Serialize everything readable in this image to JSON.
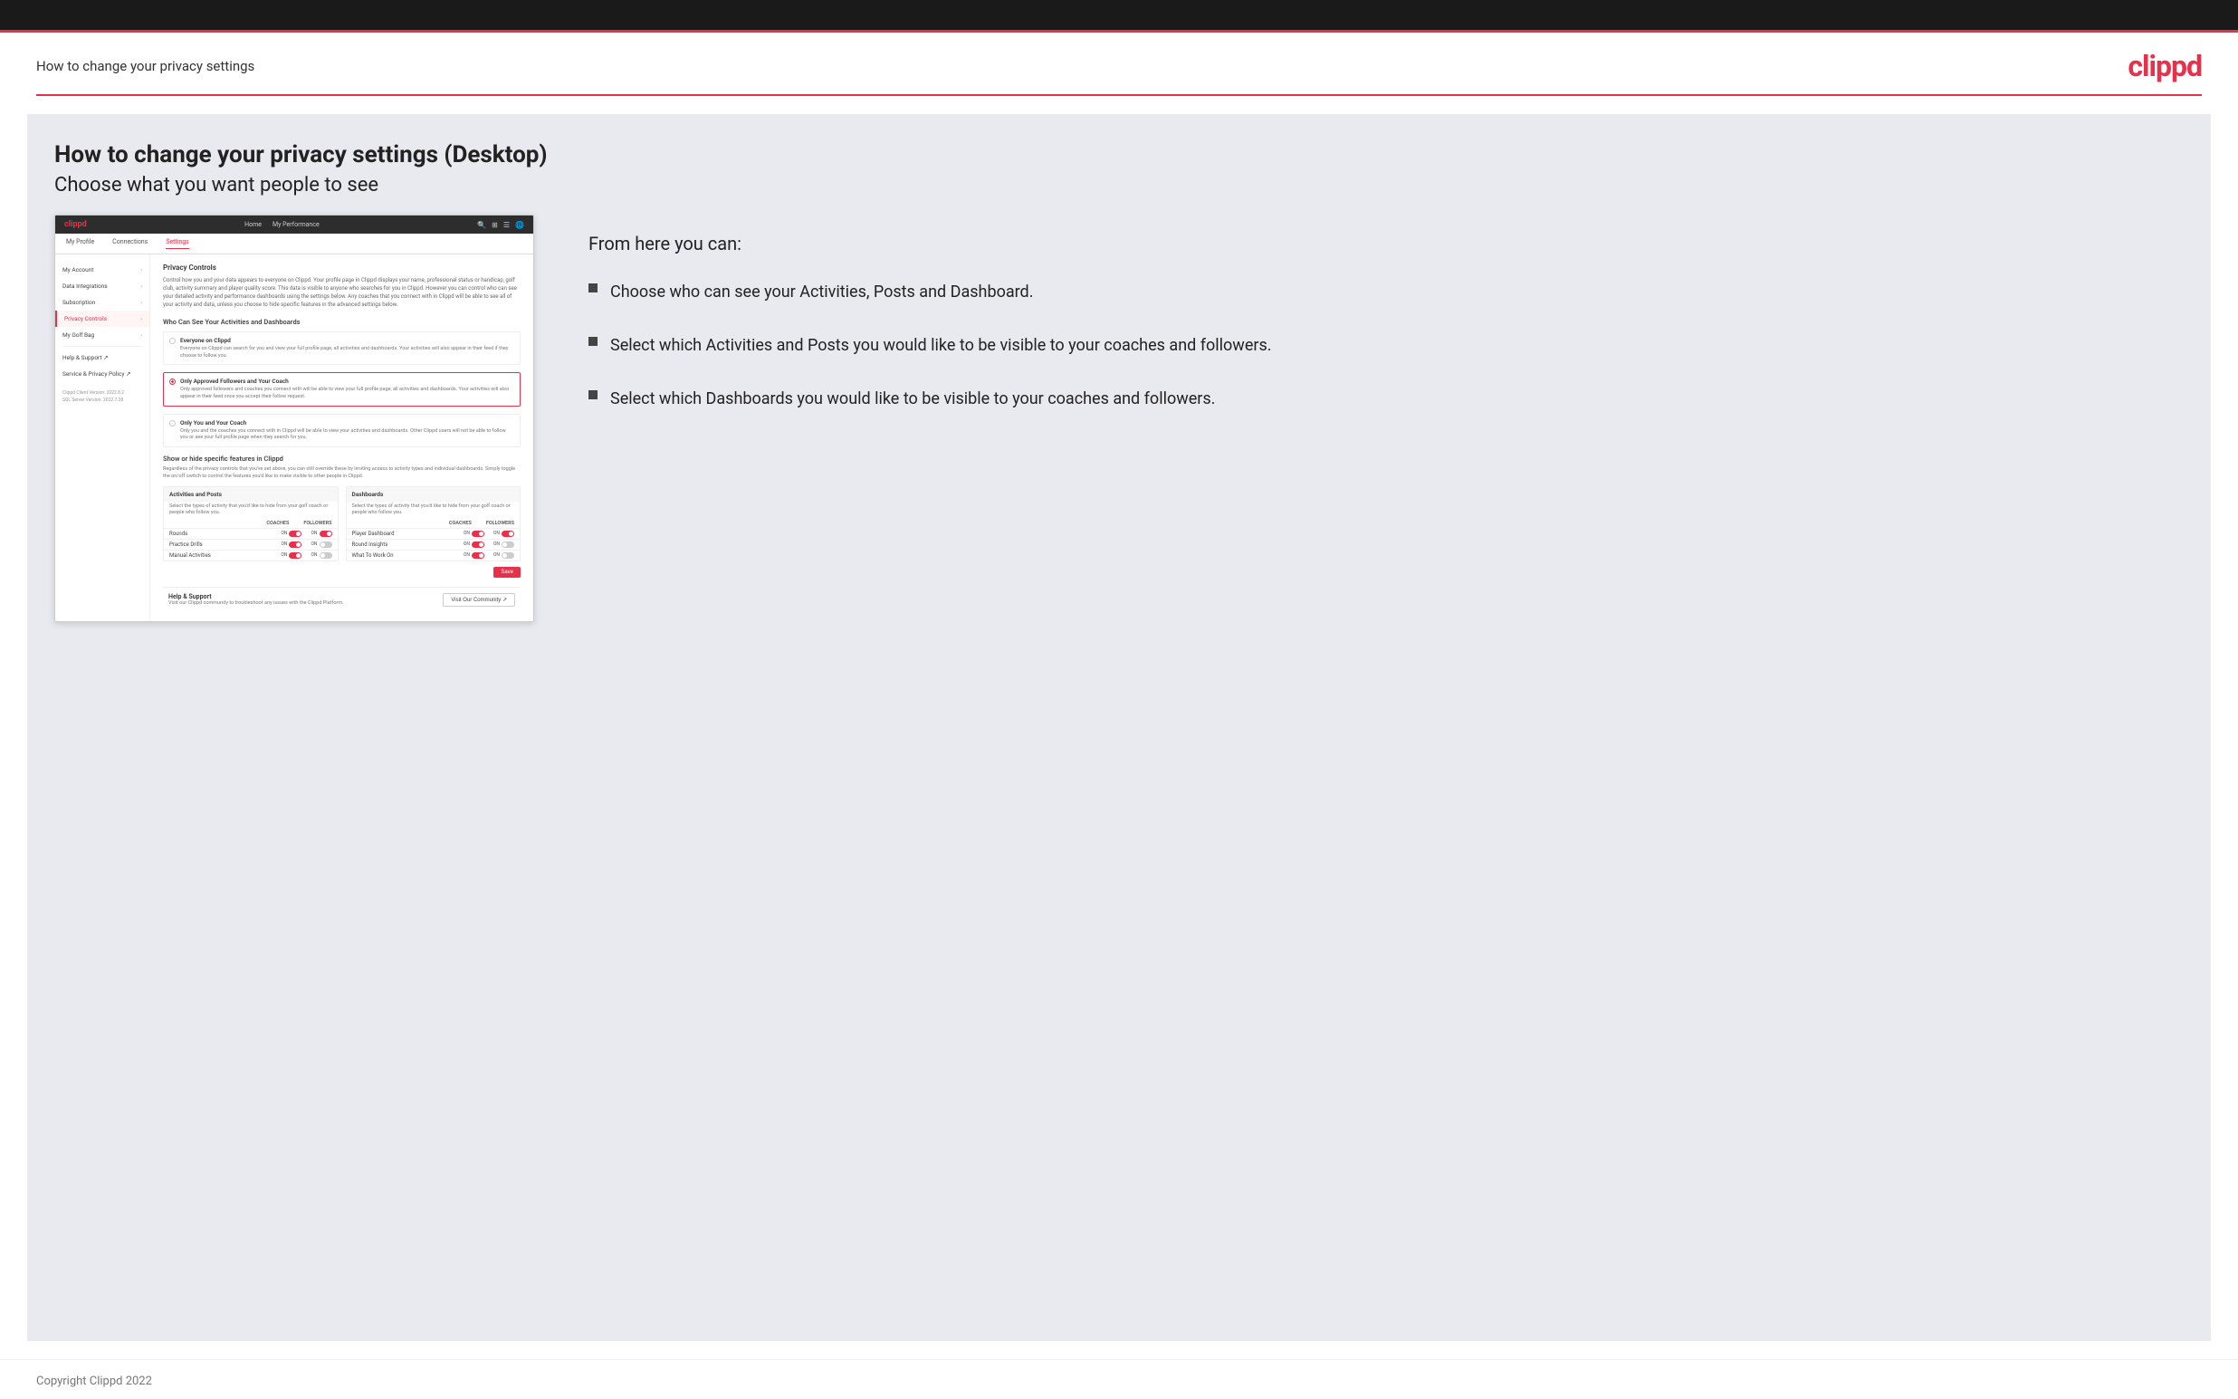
{
  "topBar": {},
  "header": {
    "title": "How to change your privacy settings",
    "logo": "clippd"
  },
  "main": {
    "title": "How to change your privacy settings (Desktop)",
    "subtitle": "Choose what you want people to see",
    "mockup": {
      "nav": {
        "logo": "clippd",
        "links": [
          "Home",
          "My Performance"
        ],
        "icons": [
          "🔍",
          "⊞",
          "☰",
          "🌐"
        ]
      },
      "subnav": [
        "My Profile",
        "Connections",
        "Settings"
      ],
      "activeSubnav": "Settings",
      "sidebar": {
        "items": [
          {
            "label": "My Account",
            "active": false
          },
          {
            "label": "Data Integrations",
            "active": false
          },
          {
            "label": "Subscription",
            "active": false
          },
          {
            "label": "Privacy Controls",
            "active": true
          },
          {
            "label": "My Golf Bag",
            "active": false
          },
          {
            "label": "Help & Support ↗",
            "active": false
          },
          {
            "label": "Service & Privacy Policy ↗",
            "active": false
          }
        ],
        "version": "Clippd Client Version: 2022.8.2\nSQL Server Version: 2022.7.38"
      },
      "privacyControls": {
        "sectionTitle": "Privacy Controls",
        "sectionDesc": "Control how you and your data appears to everyone on Clippd. Your profile page in Clippd displays your name, professional status or handicap, golf club, activity summary and player quality score. This data is visible to anyone who searches for you in Clippd. However you can control who can see your detailed activity and performance dashboards using the settings below. Any coaches that you connect with in Clippd will be able to see all of your activity and data, unless you choose to hide specific features in the advanced settings below.",
        "whoTitle": "Who Can See Your Activities and Dashboards",
        "options": [
          {
            "label": "Everyone on Clippd",
            "desc": "Everyone on Clippd can search for you and view your full profile page, all activities and dashboards. Your activities will also appear in their feed if they choose to follow you.",
            "selected": false
          },
          {
            "label": "Only Approved Followers and Your Coach",
            "desc": "Only approved followers and coaches you connect with will be able to view your full profile page, all activities and dashboards. Your activities will also appear in their feed once you accept their follow request.",
            "selected": true
          },
          {
            "label": "Only You and Your Coach",
            "desc": "Only you and the coaches you connect with in Clippd will be able to view your activities and dashboards. Other Clippd users will not be able to follow you or see your full profile page when they search for you.",
            "selected": false
          }
        ],
        "showTitle": "Show or hide specific features in Clippd",
        "showDesc": "Regardless of the privacy controls that you've set above, you can still override these by limiting access to activity types and individual dashboards. Simply toggle the on/off switch to control the features you'd like to make visible to other people in Clippd.",
        "activitiesTable": {
          "title": "Activities and Posts",
          "desc": "Select the types of activity that you'd like to hide from your golf coach or people who follow you.",
          "colHeaders": [
            "COACHES",
            "FOLLOWERS"
          ],
          "rows": [
            {
              "label": "Rounds",
              "coachesOn": true,
              "followersOn": true
            },
            {
              "label": "Practice Drills",
              "coachesOn": true,
              "followersOn": false
            },
            {
              "label": "Manual Activities",
              "coachesOn": true,
              "followersOn": false
            }
          ]
        },
        "dashboardsTable": {
          "title": "Dashboards",
          "desc": "Select the types of activity that you'd like to hide from your golf coach or people who follow you.",
          "colHeaders": [
            "COACHES",
            "FOLLOWERS"
          ],
          "rows": [
            {
              "label": "Player Dashboard",
              "coachesOn": true,
              "followersOn": true
            },
            {
              "label": "Round Insights",
              "coachesOn": true,
              "followersOn": false
            },
            {
              "label": "What To Work On",
              "coachesOn": true,
              "followersOn": false
            }
          ]
        },
        "saveButton": "Save",
        "helpSection": {
          "title": "Help & Support",
          "desc": "Visit our Clippd community to troubleshoot any issues with the Clippd Platform.",
          "communityButton": "Visit Our Community ↗"
        }
      }
    },
    "infoPanel": {
      "fromTitle": "From here you can:",
      "bullets": [
        "Choose who can see your Activities, Posts and Dashboard.",
        "Select which Activities and Posts you would like to be visible to your coaches and followers.",
        "Select which Dashboards you would like to be visible to your coaches and followers."
      ]
    }
  },
  "footer": {
    "copyright": "Copyright Clippd 2022"
  }
}
